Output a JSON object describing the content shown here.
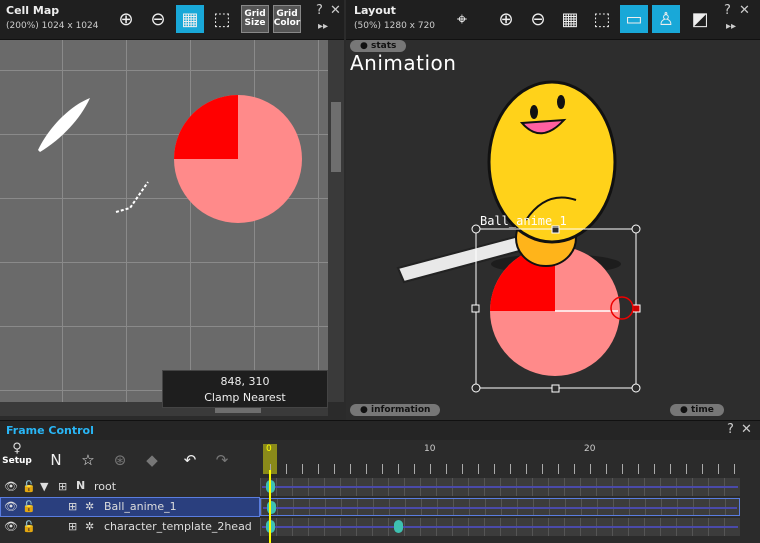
{
  "cellmap": {
    "title": "Cell Map",
    "zoom_info": "(200%) 1024 x 1024",
    "coord": "848, 310",
    "filter": "Clamp  Nearest",
    "help": "?",
    "close": "✕",
    "more": "▸▸"
  },
  "cellmap_toolbar": {
    "grid_size_line1": "Grid",
    "grid_size_line2": "Size",
    "grid_color_line1": "Grid",
    "grid_color_line2": "Color"
  },
  "layout": {
    "title": "Layout",
    "zoom_info": "(50%) 1280 x 720",
    "help": "?",
    "close": "✕",
    "more": "▸▸",
    "canvas_title": "Animation",
    "tab_stats": "● stats",
    "tab_information": "● information",
    "tab_time": "● time",
    "part_label": "Ball_anime_1"
  },
  "frame_control": {
    "title": "Frame Control",
    "help": "?",
    "close": "✕",
    "setup_label": "Setup",
    "frame_numbers": [
      "0",
      "10",
      "20"
    ],
    "layers": [
      {
        "label": "root"
      },
      {
        "label": "Ball_anime_1"
      },
      {
        "label": "character_template_2head"
      }
    ]
  },
  "colors": {
    "accent": "#19a8d8",
    "pie_light": "#ff8a8a",
    "pie_dark": "#ff0000",
    "ball": "#ffd21a",
    "frame_title": "#29b6f6"
  }
}
